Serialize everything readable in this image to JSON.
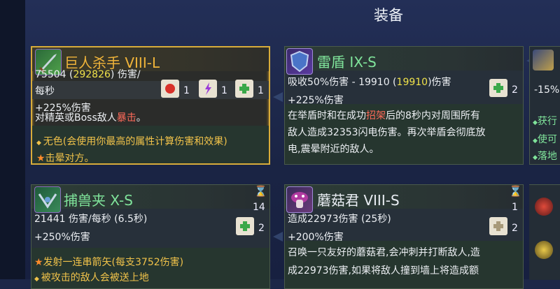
{
  "screen_title": "装备",
  "cards": {
    "giant_slayer": {
      "name": "巨人杀手 VIII-L",
      "damage_prefix": "75504 (",
      "damage_hl": "292826",
      "damage_suffix": ") 伤害/",
      "per_second": "每秒",
      "counts": [
        "1",
        "1",
        "1"
      ],
      "bonus": "+225%伤害",
      "effect_prefix": "对精英或Boss敌人",
      "effect_hl": "暴击",
      "effect_suffix": "。",
      "note1": "无色(会使用你最高的属性计算伤害和效果)",
      "note2": "击晕对方。"
    },
    "thunder_shield": {
      "name": "雷盾 IX-S",
      "stat_prefix": "吸收50%伤害 - 19910 (",
      "stat_hl": "19910",
      "stat_suffix": ")伤害",
      "count": "2",
      "bonus": "+225%伤害",
      "desc1_prefix": "在举盾时和在成功",
      "desc1_hl": "招架",
      "desc1_suffix": "后的8秒内对周围所有",
      "desc2": "敌人造成32353闪电伤害。再次举盾会彻底放",
      "desc3": "电,震晕附近的敌人。"
    },
    "beast_trap": {
      "name": "捕兽夹 X-S",
      "cooldown": "14",
      "stat": "21441 伤害/每秒 (6.5秒)",
      "count": "2",
      "bonus": "+250%伤害",
      "effect1": "发射一连串箭矢(每支3752伤害)",
      "effect2": "被攻击的敌人会被送上地"
    },
    "mushroom_boi": {
      "name": "蘑菇君 VIII-S",
      "cooldown": "1",
      "stat": "造成22973伤害 (25秒)",
      "count": "2",
      "bonus": "+200%伤害",
      "desc1": "召唤一只友好的蘑菇君,会冲刺并打断敌人,造",
      "desc2": "成22973伤害,如果将敌人撞到墙上将造成额"
    },
    "partial": {
      "line1": "-15%",
      "item1": "获行",
      "item2": "使可",
      "item3": "落地"
    }
  },
  "colors": {
    "gold_border": "#d8ac3a",
    "name_green": "#7fe39a",
    "name_gold": "#f0b43a",
    "highlight_yellow": "#f0e24a",
    "crit_red": "#ff6a5a"
  }
}
